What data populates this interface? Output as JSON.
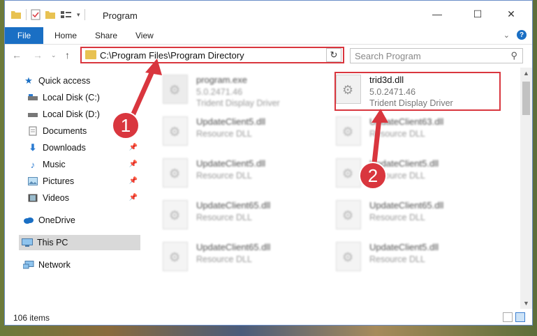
{
  "window": {
    "title": "Program"
  },
  "ribbon": {
    "tabs": [
      "File",
      "Home",
      "Share",
      "View"
    ]
  },
  "address": {
    "path": "C:\\Program Files\\Program Directory"
  },
  "search": {
    "placeholder": "Search Program"
  },
  "nav": {
    "items": [
      {
        "label": "Quick access",
        "icon": "star-icon"
      },
      {
        "label": "Local Disk (C:)",
        "icon": "drive-icon"
      },
      {
        "label": "Local Disk (D:)",
        "icon": "drive-icon"
      },
      {
        "label": "Documents",
        "icon": "document-icon"
      },
      {
        "label": "Downloads",
        "icon": "download-icon"
      },
      {
        "label": "Music",
        "icon": "music-icon"
      },
      {
        "label": "Pictures",
        "icon": "picture-icon"
      },
      {
        "label": "Videos",
        "icon": "video-icon"
      },
      {
        "label": "OneDrive",
        "icon": "cloud-icon"
      },
      {
        "label": "This PC",
        "icon": "computer-icon"
      },
      {
        "label": "Network",
        "icon": "network-icon"
      }
    ]
  },
  "files": [
    {
      "name": "program.exe",
      "version": "5.0.2471.46",
      "desc": "Trident Display Driver"
    },
    {
      "name": "trid3d.dll",
      "version": "5.0.2471.46",
      "desc": "Trident Display Driver"
    },
    {
      "name": "UpdateClient5.dll",
      "desc": "Resource DLL"
    },
    {
      "name": "UpdateClient63.dll",
      "desc": "Resource DLL"
    },
    {
      "name": "UpdateClient5.dll",
      "desc": "Resource DLL"
    },
    {
      "name": "UpdateClient5.dll",
      "desc": "Resource DLL"
    },
    {
      "name": "UpdateClient65.dll",
      "desc": "Resource DLL"
    },
    {
      "name": "UpdateClient65.dll",
      "desc": "Resource DLL"
    },
    {
      "name": "UpdateClient65.dll",
      "desc": "Resource DLL"
    },
    {
      "name": "UpdateClient5.dll",
      "desc": "Resource DLL"
    }
  ],
  "status": {
    "count": "106 items"
  },
  "annotations": {
    "step1": "1",
    "step2": "2"
  },
  "colors": {
    "accent": "#1a6fc4",
    "annotation": "#d9363e"
  }
}
